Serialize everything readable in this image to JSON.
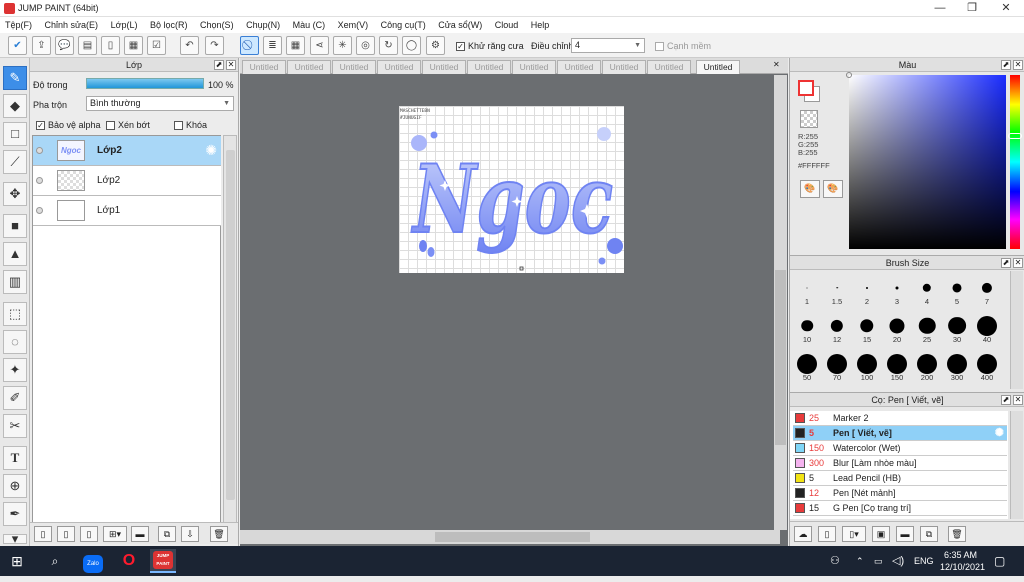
{
  "window": {
    "title": "JUMP PAINT (64bit)",
    "minimize": "—",
    "maximize": "❐",
    "close": "✕"
  },
  "menu": [
    "Tệp(F)",
    "Chỉnh sửa(E)",
    "Lớp(L)",
    "Bộ lọc(R)",
    "Chọn(S)",
    "Chụp(N)",
    "Màu (C)",
    "Xem(V)",
    "Công cụ(T)",
    "Cửa sổ(W)",
    "Cloud",
    "Help"
  ],
  "toolbar": {
    "antialias_label": "Khử răng cưa",
    "adjust_label": "Điều chỉnh",
    "adjust_value": "4",
    "snap_label": "Cạnh mềm"
  },
  "layer_panel": {
    "title": "Lớp",
    "opacity_label": "Độ trong",
    "opacity_value": "100 %",
    "opacity_fraction": 1.0,
    "blend_label": "Pha trộn",
    "blend_value": "Bình thường",
    "protect_alpha": "Bảo vệ alpha",
    "clip": "Xén bớt",
    "lock": "Khóa",
    "layers": [
      {
        "name": "Lớp2",
        "selected": true
      },
      {
        "name": "Lớp2",
        "selected": false
      },
      {
        "name": "Lớp1",
        "selected": false
      }
    ]
  },
  "tabs": [
    "Untitled",
    "Untitled",
    "Untitled",
    "Untitled",
    "Untitled",
    "Untitled",
    "Untitled",
    "Untitled",
    "Untitled",
    "Untitled",
    "Untitled"
  ],
  "active_tab_index": 10,
  "artwork": {
    "text": "Ngoc",
    "color_main": "#7b8ff5",
    "color_light": "#c6d0fb"
  },
  "color_panel": {
    "title": "Màu",
    "r": "R:255",
    "g": "G:255",
    "b": "B:255",
    "hex": "#FFFFFF",
    "hue_color": "#1a2cff"
  },
  "brush_size": {
    "title": "Brush Size",
    "sizes": [
      "1",
      "1.5",
      "2",
      "3",
      "4",
      "5",
      "7",
      "10",
      "12",
      "15",
      "20",
      "25",
      "30",
      "40",
      "50",
      "70",
      "100",
      "150",
      "200",
      "300",
      "400"
    ]
  },
  "brush_list": {
    "title": "Cọ: Pen [ Viết, vẽ]",
    "items": [
      {
        "size": "25",
        "name": "Marker 2",
        "color": "#e83b3b",
        "size_color": "#e83b3b"
      },
      {
        "size": "5",
        "name": "Pen [ Viết, vẽ]",
        "color": "#222222",
        "size_color": "#e83b3b",
        "selected": true
      },
      {
        "size": "150",
        "name": "Watercolor (Wet)",
        "color": "#7fd6f7",
        "size_color": "#e83b3b"
      },
      {
        "size": "300",
        "name": "Blur [Làm nhòe màu]",
        "color": "#f5b3ef",
        "size_color": "#e83b3b"
      },
      {
        "size": "5",
        "name": "Lead Pencil (HB)",
        "color": "#f2e313",
        "size_color": "#222222"
      },
      {
        "size": "12",
        "name": "Pen [Nét mảnh]",
        "color": "#222222",
        "size_color": "#e83b3b"
      },
      {
        "size": "15",
        "name": "G Pen [Cọ trang trí]",
        "color": "#e83b3b",
        "size_color": "#222222"
      }
    ]
  },
  "taskbar": {
    "lang": "ENG",
    "time": "6:35 AM",
    "date": "12/10/2021",
    "zalo": "Zalo",
    "app": "JUMP PAINT"
  }
}
